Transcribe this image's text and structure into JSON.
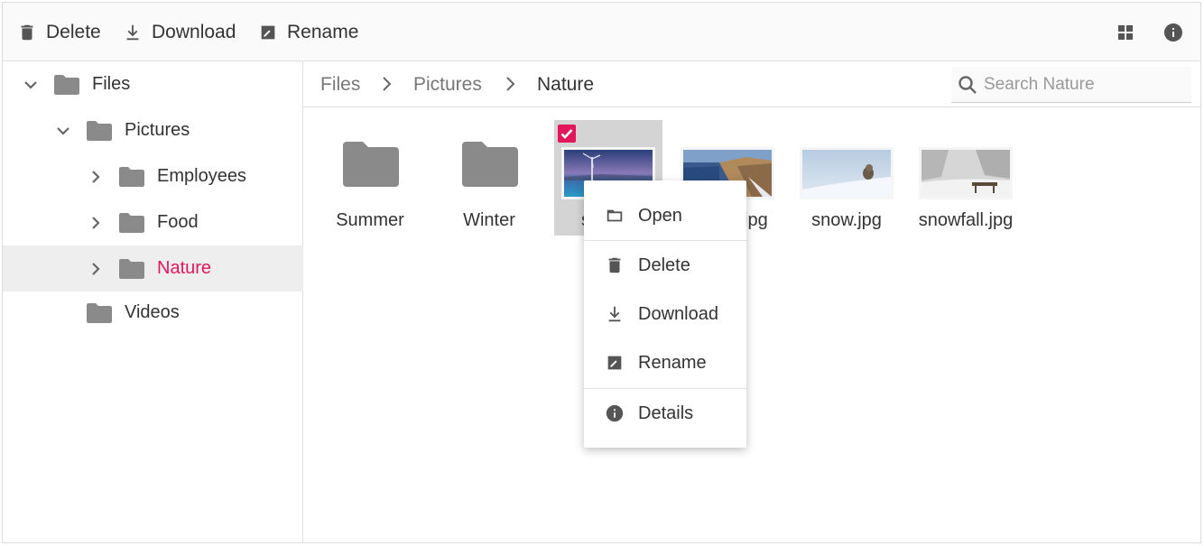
{
  "toolbar": {
    "delete_label": "Delete",
    "download_label": "Download",
    "rename_label": "Rename"
  },
  "nav": {
    "items": [
      {
        "label": "Files",
        "level": 0,
        "expanded": true
      },
      {
        "label": "Pictures",
        "level": 1,
        "expanded": true
      },
      {
        "label": "Employees",
        "level": 2,
        "expanded": false
      },
      {
        "label": "Food",
        "level": 2,
        "expanded": false
      },
      {
        "label": "Nature",
        "level": 2,
        "expanded": false,
        "selected": true
      },
      {
        "label": "Videos",
        "level": 1
      }
    ]
  },
  "breadcrumb": [
    "Files",
    "Pictures",
    "Nature"
  ],
  "search": {
    "placeholder": "Search Nature",
    "value": ""
  },
  "files": [
    {
      "name": "Summer",
      "type": "folder"
    },
    {
      "name": "Winter",
      "type": "folder"
    },
    {
      "name": "sea.jpg",
      "type": "image",
      "selected": true
    },
    {
      "name": "seaview.jpg",
      "type": "image"
    },
    {
      "name": "snow.jpg",
      "type": "image"
    },
    {
      "name": "snowfall.jpg",
      "type": "image"
    }
  ],
  "visible_names": {
    "item_3": "s",
    "item_4": "jpg"
  },
  "context_menu": {
    "open": "Open",
    "delete": "Delete",
    "download": "Download",
    "rename": "Rename",
    "details": "Details"
  },
  "colors": {
    "accent": "#e3165b",
    "icon": "#555555",
    "folder": "#8a8a8a",
    "selected_bg": "#eeeeee"
  }
}
